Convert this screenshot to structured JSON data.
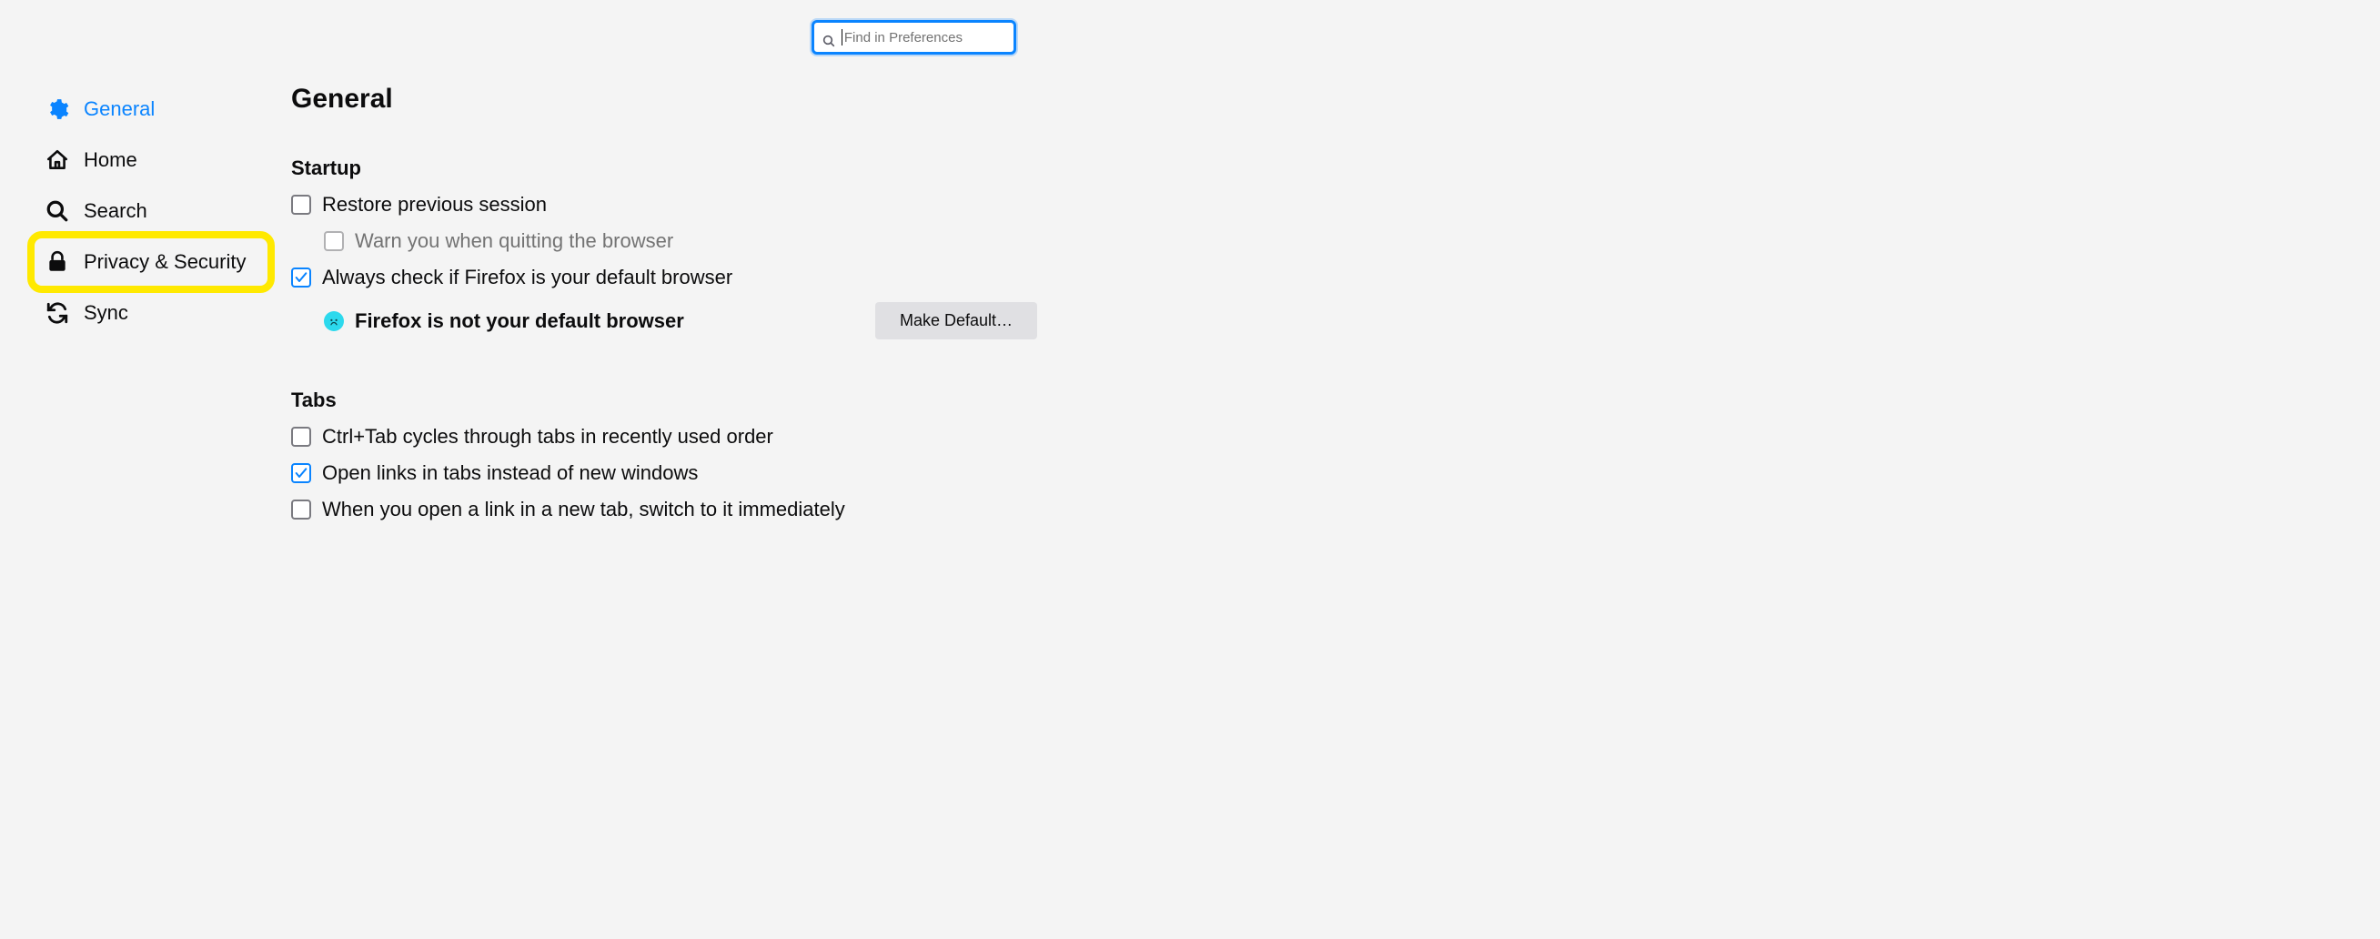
{
  "search": {
    "placeholder": "Find in Preferences",
    "value": ""
  },
  "sidebar": {
    "items": [
      {
        "label": "General",
        "active": true
      },
      {
        "label": "Home"
      },
      {
        "label": "Search"
      },
      {
        "label": "Privacy & Security",
        "highlight": true
      },
      {
        "label": "Sync"
      }
    ]
  },
  "page": {
    "title": "General"
  },
  "sections": {
    "startup": {
      "heading": "Startup",
      "restore_previous": {
        "label": "Restore previous session",
        "checked": false
      },
      "warn_quit": {
        "label": "Warn you when quitting the browser",
        "checked": false,
        "disabled": true
      },
      "always_check_default": {
        "label": "Always check if Firefox is your default browser",
        "checked": true
      },
      "default_status": "Firefox is not your default browser",
      "make_default_button": "Make Default…"
    },
    "tabs": {
      "heading": "Tabs",
      "ctrl_tab": {
        "label": "Ctrl+Tab cycles through tabs in recently used order",
        "checked": false
      },
      "open_links": {
        "label": "Open links in tabs instead of new windows",
        "checked": true
      },
      "switch_immediately": {
        "label": "When you open a link in a new tab, switch to it immediately",
        "checked": false
      }
    }
  }
}
